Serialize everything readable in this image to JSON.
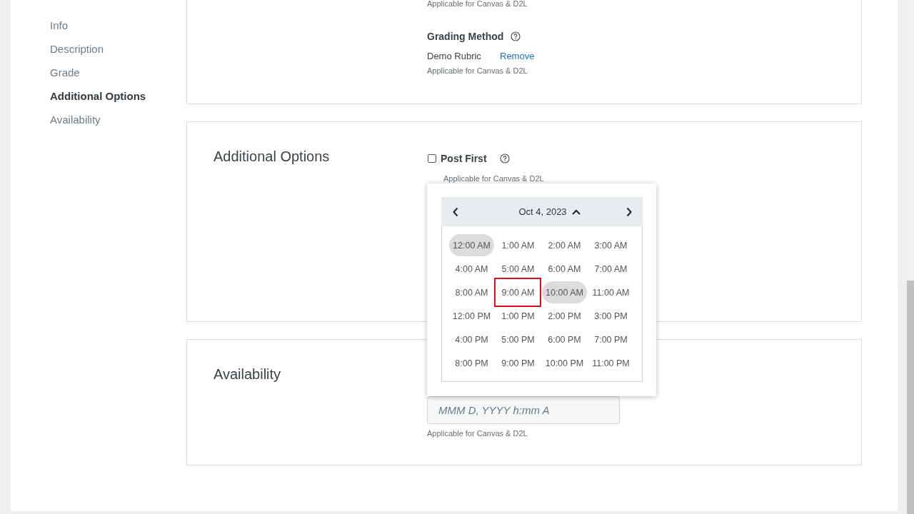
{
  "sidebar": {
    "items": [
      {
        "label": "Info",
        "selected": false
      },
      {
        "label": "Description",
        "selected": false
      },
      {
        "label": "Grade",
        "selected": false
      },
      {
        "label": "Additional Options",
        "selected": true
      },
      {
        "label": "Availability",
        "selected": false
      }
    ]
  },
  "grading_section": {
    "platform_note": "Applicable for Canvas & D2L",
    "grading_method": {
      "label": "Grading Method",
      "value": "Demo Rubric",
      "remove_link": "Remove",
      "platform_note": "Applicable for Canvas & D2L"
    }
  },
  "additional_options": {
    "title": "Additional Options",
    "post_first": {
      "label": "Post First",
      "checked": false,
      "platform_note": "Applicable for Canvas & D2L"
    }
  },
  "time_picker": {
    "date": "Oct 4, 2023",
    "times": [
      {
        "label": "12:00 AM",
        "selected": true,
        "annotated": false
      },
      {
        "label": "1:00 AM",
        "selected": false,
        "annotated": false
      },
      {
        "label": "2:00 AM",
        "selected": false,
        "annotated": false
      },
      {
        "label": "3:00 AM",
        "selected": false,
        "annotated": false
      },
      {
        "label": "4:00 AM",
        "selected": false,
        "annotated": false
      },
      {
        "label": "5:00 AM",
        "selected": false,
        "annotated": false
      },
      {
        "label": "6:00 AM",
        "selected": false,
        "annotated": false
      },
      {
        "label": "7:00 AM",
        "selected": false,
        "annotated": false
      },
      {
        "label": "8:00 AM",
        "selected": false,
        "annotated": false
      },
      {
        "label": "9:00 AM",
        "selected": false,
        "annotated": true
      },
      {
        "label": "10:00 AM",
        "selected": true,
        "annotated": false
      },
      {
        "label": "11:00 AM",
        "selected": false,
        "annotated": false
      },
      {
        "label": "12:00 PM",
        "selected": false,
        "annotated": false
      },
      {
        "label": "1:00 PM",
        "selected": false,
        "annotated": false
      },
      {
        "label": "2:00 PM",
        "selected": false,
        "annotated": false
      },
      {
        "label": "3:00 PM",
        "selected": false,
        "annotated": false
      },
      {
        "label": "4:00 PM",
        "selected": false,
        "annotated": false
      },
      {
        "label": "5:00 PM",
        "selected": false,
        "annotated": false
      },
      {
        "label": "6:00 PM",
        "selected": false,
        "annotated": false
      },
      {
        "label": "7:00 PM",
        "selected": false,
        "annotated": false
      },
      {
        "label": "8:00 PM",
        "selected": false,
        "annotated": false
      },
      {
        "label": "9:00 PM",
        "selected": false,
        "annotated": false
      },
      {
        "label": "10:00 PM",
        "selected": false,
        "annotated": false
      },
      {
        "label": "11:00 PM",
        "selected": false,
        "annotated": false
      }
    ]
  },
  "availability": {
    "title": "Availability",
    "date_field": {
      "placeholder": "MMM D, YYYY h:mm A"
    },
    "platform_note": "Applicable for Canvas & D2L"
  }
}
